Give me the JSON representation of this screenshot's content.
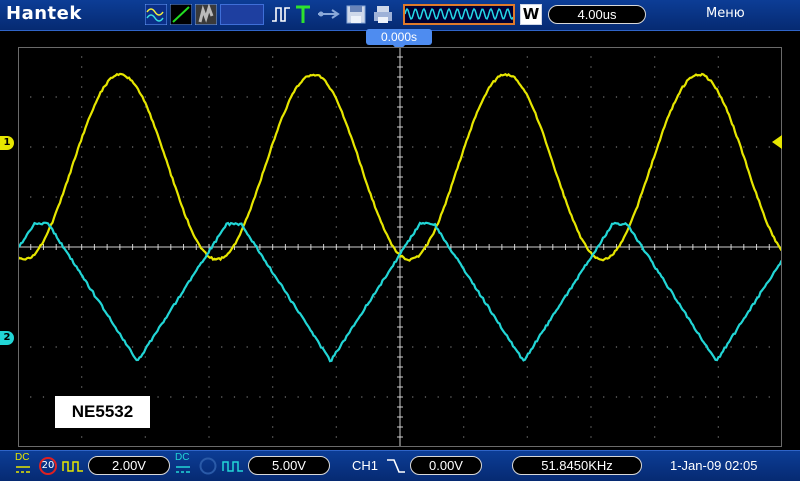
{
  "app": {
    "brand": "Hantek",
    "menu_label": "Меню"
  },
  "toolbar": {
    "icons": [
      "wave-normal-icon",
      "vector-line-icon",
      "dots-icon",
      "blank-box-icon",
      "pulse-icon",
      "trigger-t-icon",
      "usb-icon",
      "save-icon",
      "print-icon"
    ],
    "timebase": "4.00us",
    "mode_letter": "W"
  },
  "trigger_position": {
    "label": "0.000s"
  },
  "overlay_note": {
    "text": "NE5532"
  },
  "channels": [
    {
      "id": "1",
      "color": "#e6e600",
      "coupling": "DC",
      "volts_div": "2.00V",
      "bw_label": "20"
    },
    {
      "id": "2",
      "color": "#22d6d6",
      "coupling": "DC",
      "volts_div": "5.00V"
    }
  ],
  "trigger": {
    "source": "CH1",
    "level": "0.00V"
  },
  "measurement": {
    "frequency": "51.8450KHz"
  },
  "datetime": "1-Jan-09 02:05",
  "traces": {
    "ch1": {
      "shape": "sine",
      "period_divisions": 3.03,
      "amplitude_divisions": 1.85,
      "center_divisions_from_top": 2.4
    },
    "ch2": {
      "shape": "clipped-triangle",
      "period_divisions": 3.03,
      "amplitude_divisions": 1.35,
      "center_divisions_from_top": 4.8
    }
  }
}
